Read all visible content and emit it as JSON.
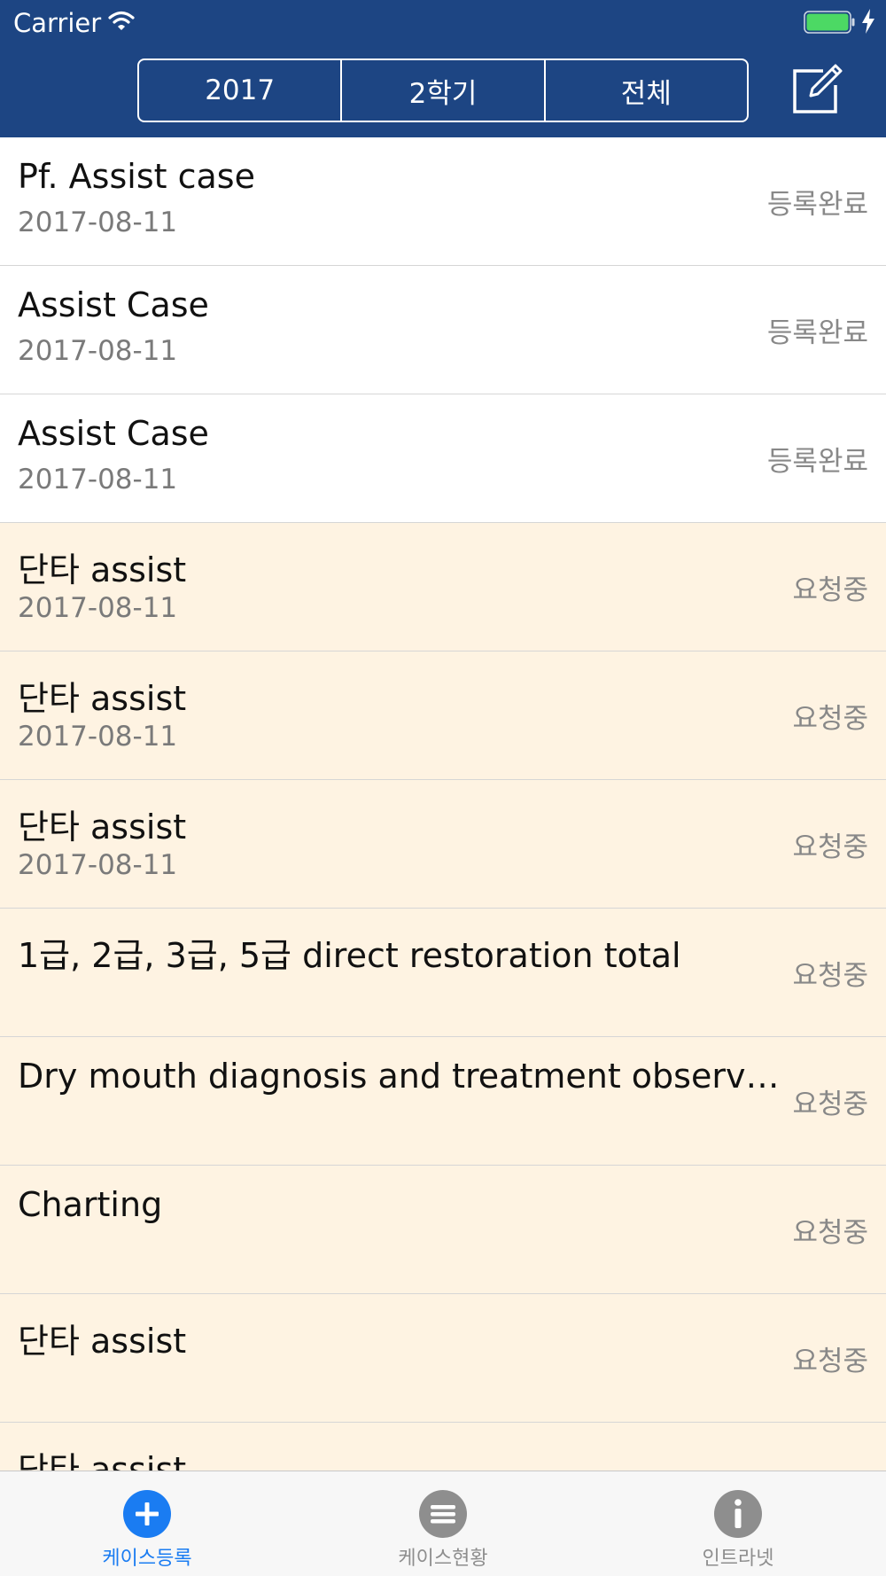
{
  "status_bar": {
    "carrier": "Carrier",
    "battery_color": "#4cd964"
  },
  "filters": {
    "year": "2017",
    "semester": "2학기",
    "scope": "전체"
  },
  "cases": [
    {
      "title": "Pf. Assist case",
      "date": "2017-08-11",
      "status": "등록완료",
      "state": "done"
    },
    {
      "title": "Assist Case",
      "date": "2017-08-11",
      "status": "등록완료",
      "state": "done"
    },
    {
      "title": "Assist Case",
      "date": "2017-08-11",
      "status": "등록완료",
      "state": "done"
    },
    {
      "title": "단타 assist",
      "date": "2017-08-11",
      "status": "요청중",
      "state": "pending"
    },
    {
      "title": "단타 assist",
      "date": "2017-08-11",
      "status": "요청중",
      "state": "pending"
    },
    {
      "title": "단타 assist",
      "date": "2017-08-11",
      "status": "요청중",
      "state": "pending"
    },
    {
      "title": "1급, 2급, 3급, 5급 direct restoration total",
      "date": "",
      "status": "요청중",
      "state": "pending"
    },
    {
      "title": "Dry mouth diagnosis and treatment observati...",
      "date": "",
      "status": "요청중",
      "state": "pending"
    },
    {
      "title": "Charting",
      "date": "",
      "status": "요청중",
      "state": "pending"
    },
    {
      "title": "단타 assist",
      "date": "",
      "status": "요청중",
      "state": "pending"
    },
    {
      "title": "단타 assist",
      "date": "",
      "status": "",
      "state": "pending"
    }
  ],
  "tabs": [
    {
      "label": "케이스등록",
      "icon": "plus-circle-icon",
      "active": true
    },
    {
      "label": "케이스현황",
      "icon": "list-circle-icon",
      "active": false
    },
    {
      "label": "인트라넷",
      "icon": "info-circle-icon",
      "active": false
    }
  ],
  "colors": {
    "header": "#1d4583",
    "accent": "#1a7cf2",
    "pending_row": "#fef3e2",
    "inactive_icon": "#8e8e8e"
  }
}
